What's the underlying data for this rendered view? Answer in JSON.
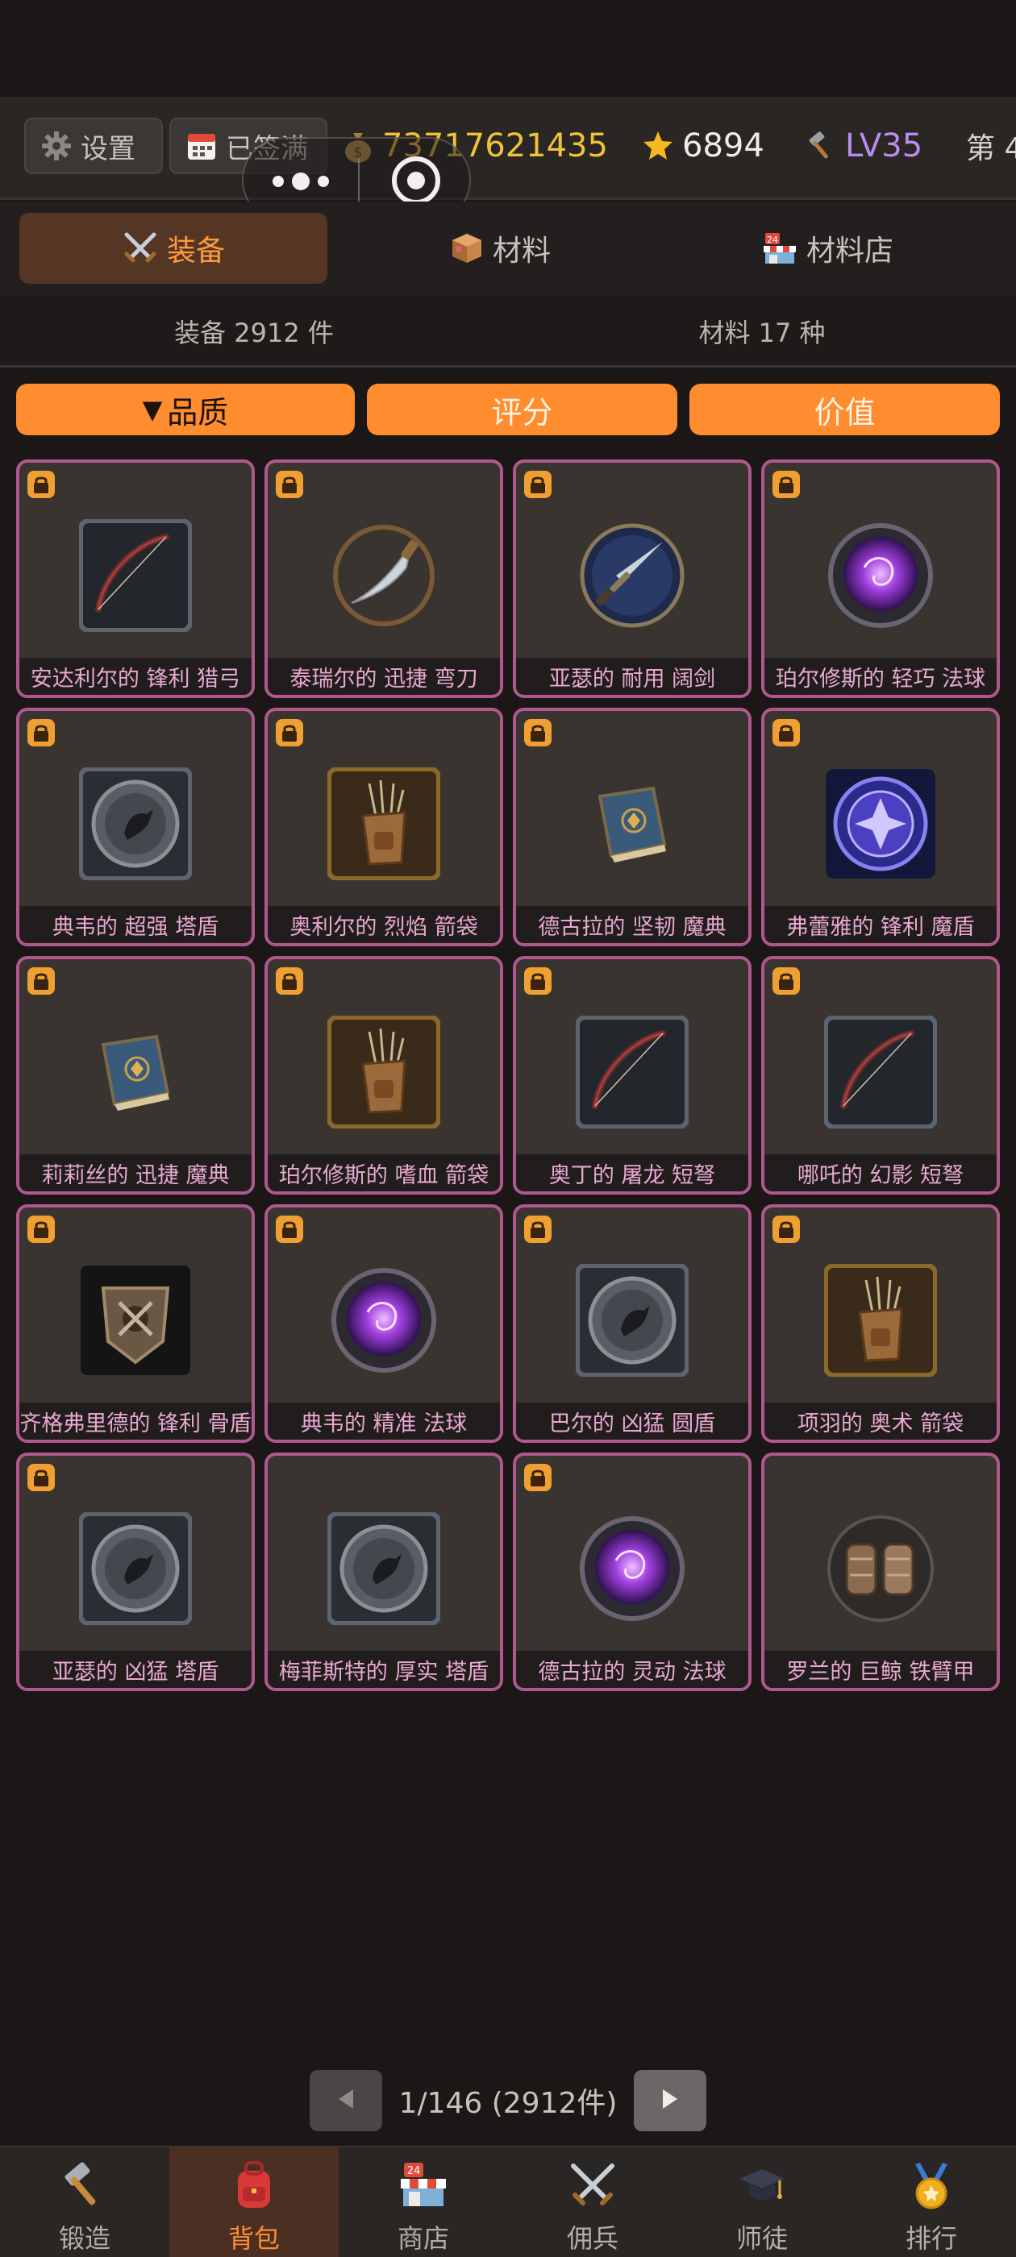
{
  "topbar": {
    "settings_label": "设置",
    "signin_label": "已签满",
    "gold": "73717621435",
    "stars": "6894",
    "level": "LV35",
    "floor": "第 4"
  },
  "tabs": [
    {
      "label": "装备",
      "active": true
    },
    {
      "label": "材料",
      "active": false
    },
    {
      "label": "材料店",
      "active": false
    }
  ],
  "counts": {
    "equipment": "装备 2912 件",
    "materials": "材料 17 种"
  },
  "sort": {
    "quality": "品质",
    "score": "评分",
    "value": "价值"
  },
  "items": [
    {
      "name": "安达利尔的 锋利 猎弓",
      "locked": true,
      "icon": "bow-icon"
    },
    {
      "name": "泰瑞尔的 迅捷 弯刀",
      "locked": true,
      "icon": "scimitar-icon"
    },
    {
      "name": "亚瑟的 耐用 阔剑",
      "locked": true,
      "icon": "broadsword-icon"
    },
    {
      "name": "珀尔修斯的 轻巧 法球",
      "locked": true,
      "icon": "orb-icon"
    },
    {
      "name": "典韦的 超强 塔盾",
      "locked": true,
      "icon": "tower-shield-icon"
    },
    {
      "name": "奥利尔的 烈焰 箭袋",
      "locked": true,
      "icon": "quiver-icon"
    },
    {
      "name": "德古拉的 坚韧 魔典",
      "locked": true,
      "icon": "grimoire-icon"
    },
    {
      "name": "弗蕾雅的 锋利 魔盾",
      "locked": true,
      "icon": "magic-shield-icon"
    },
    {
      "name": "莉莉丝的 迅捷 魔典",
      "locked": true,
      "icon": "grimoire-icon"
    },
    {
      "name": "珀尔修斯的 嗜血 箭袋",
      "locked": true,
      "icon": "quiver-icon"
    },
    {
      "name": "奥丁的 屠龙 短弩",
      "locked": true,
      "icon": "bow-icon"
    },
    {
      "name": "哪吒的 幻影 短弩",
      "locked": true,
      "icon": "bow-icon"
    },
    {
      "name": "齐格弗里德的 锋利 骨盾",
      "locked": true,
      "icon": "bone-shield-icon"
    },
    {
      "name": "典韦的 精准 法球",
      "locked": true,
      "icon": "orb-icon"
    },
    {
      "name": "巴尔的 凶猛 圆盾",
      "locked": true,
      "icon": "tower-shield-icon"
    },
    {
      "name": "项羽的 奥术 箭袋",
      "locked": true,
      "icon": "quiver-icon"
    },
    {
      "name": "亚瑟的 凶猛 塔盾",
      "locked": true,
      "icon": "tower-shield-icon"
    },
    {
      "name": "梅菲斯特的 厚实 塔盾",
      "locked": false,
      "icon": "tower-shield-icon"
    },
    {
      "name": "德古拉的 灵动 法球",
      "locked": true,
      "icon": "orb-icon"
    },
    {
      "name": "罗兰的 巨鲸 铁臂甲",
      "locked": false,
      "icon": "bracer-icon"
    }
  ],
  "pager": {
    "text": "1/146 (2912件)"
  },
  "nav": [
    {
      "label": "锻造",
      "icon": "hammer-icon",
      "active": false
    },
    {
      "label": "背包",
      "icon": "backpack-icon",
      "active": true
    },
    {
      "label": "商店",
      "icon": "shop-icon",
      "active": false
    },
    {
      "label": "佣兵",
      "icon": "swords-icon",
      "active": false
    },
    {
      "label": "师徒",
      "icon": "graduation-cap-icon",
      "active": false
    },
    {
      "label": "排行",
      "icon": "medal-icon",
      "active": false
    }
  ],
  "colors": {
    "accent": "#ff8c2e",
    "item_border": "#b0588e",
    "item_label": "#e8a8d0",
    "gold": "#f0c23a",
    "level": "#b98cf0"
  }
}
